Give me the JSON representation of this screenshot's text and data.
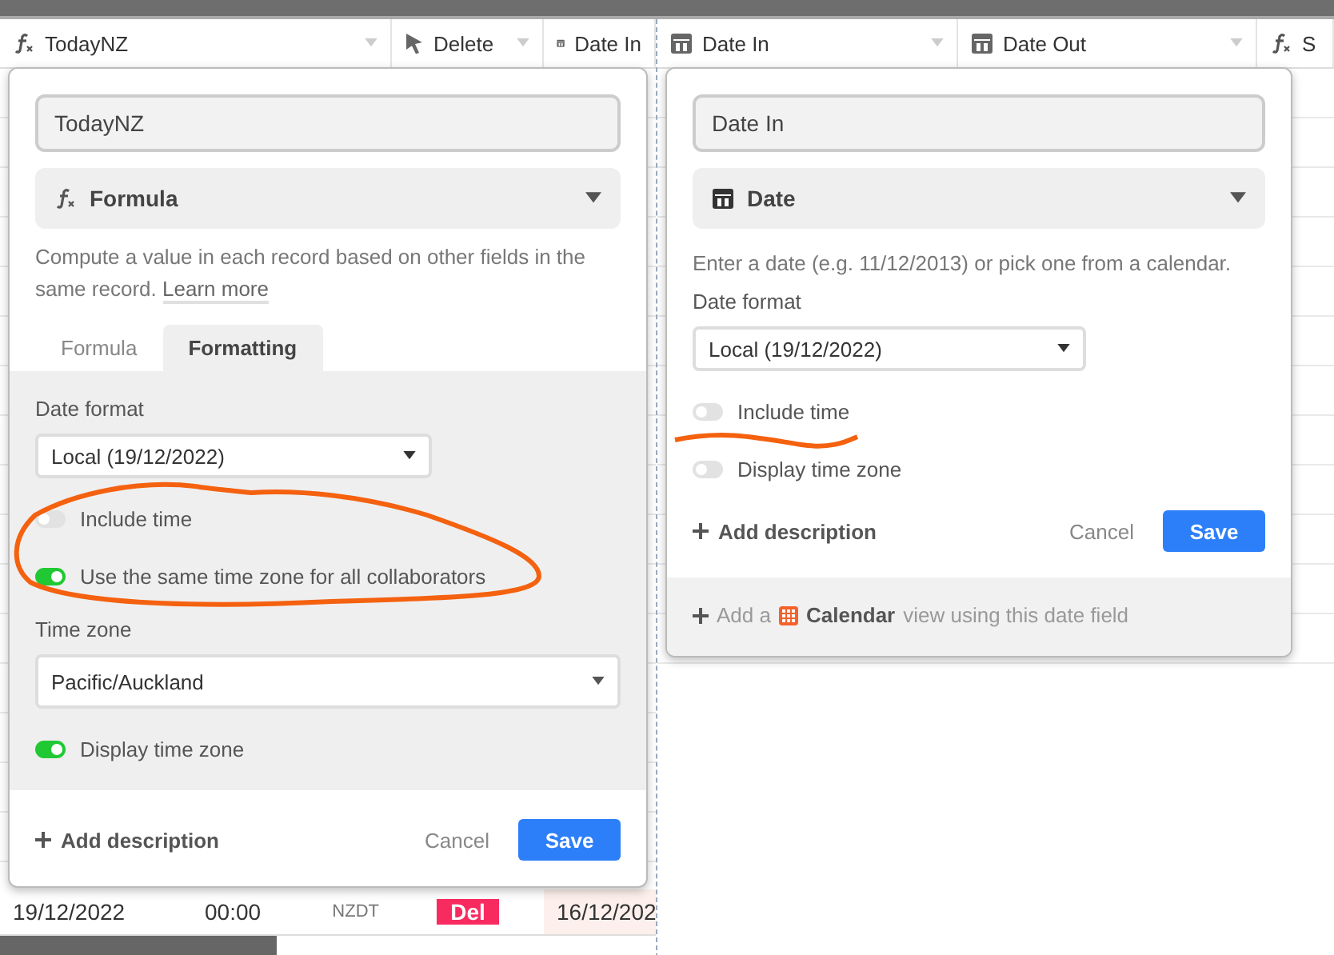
{
  "left": {
    "header": [
      {
        "kind": "formula",
        "label": "TodayNZ",
        "menu": true
      },
      {
        "kind": "cursor",
        "label": "Delete",
        "menu": true
      },
      {
        "kind": "date",
        "label": "Date In",
        "menu": false
      }
    ],
    "panel": {
      "name": "TodayNZ",
      "type": {
        "kind": "formula",
        "label": "Formula"
      },
      "description": "Compute a value in each record based on other fields in the same record.",
      "learn_more": "Learn more",
      "tabs": [
        {
          "label": "Formula",
          "selected": false
        },
        {
          "label": "Formatting",
          "selected": true
        }
      ],
      "date_format": {
        "label": "Date format",
        "value": "Local (19/12/2022)"
      },
      "toggles": [
        {
          "label": "Include time",
          "on": false
        },
        {
          "label": "Use the same time zone for all collaborators",
          "on": true
        }
      ],
      "time_zone": {
        "label": "Time zone",
        "value": "Pacific/Auckland"
      },
      "display_toggle": {
        "label": "Display time zone",
        "on": true
      },
      "add_description": "Add description",
      "cancel": "Cancel",
      "save": "Save"
    },
    "row": {
      "date": "19/12/2022",
      "time": "00:00",
      "zone": "NZDT",
      "badge": "Del",
      "date_in": "16/12/202"
    }
  },
  "right": {
    "header": [
      {
        "kind": "date",
        "label": "Date In",
        "menu": true
      },
      {
        "kind": "date",
        "label": "Date Out",
        "menu": true
      },
      {
        "kind": "formula",
        "label": "S",
        "menu": false
      }
    ],
    "panel": {
      "name": "Date In",
      "type": {
        "kind": "date",
        "label": "Date"
      },
      "description": "Enter a date (e.g. 11/12/2013) or pick one from a calendar.",
      "date_format": {
        "label": "Date format",
        "value": "Local (19/12/2022)"
      },
      "toggles": [
        {
          "label": "Include time",
          "on": false
        },
        {
          "label": "Display time zone",
          "on": false
        }
      ],
      "add_description": "Add description",
      "cancel": "Cancel",
      "save": "Save",
      "footer": {
        "prefix": "Add a",
        "view": "Calendar",
        "suffix": "view using this date field"
      }
    }
  }
}
